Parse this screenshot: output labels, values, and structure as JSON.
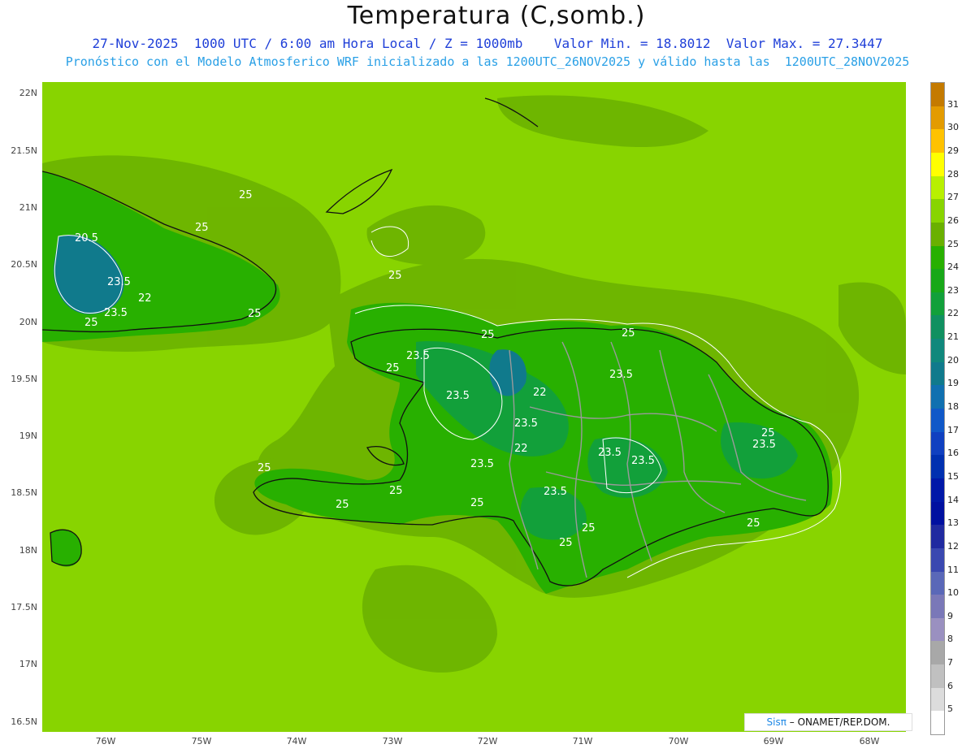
{
  "title": "Temperatura (C,somb.)",
  "subtitle_line1": "27-Nov-2025  1000 UTC / 6:00 am Hora Local / Z = 1000mb    Valor Min. = 18.8012  Valor Max. = 27.3447",
  "subtitle_line2": "Pronóstico con el Modelo Atmosferico WRF inicializado a las 1200UTC_26NOV2025 y válido hasta las  1200UTC_28NOV2025",
  "lat_labels": [
    "22N",
    "21.5N",
    "21N",
    "20.5N",
    "20N",
    "19.5N",
    "19N",
    "18.5N",
    "18N",
    "17.5N",
    "17N",
    "16.5N"
  ],
  "lon_labels": [
    "76W",
    "75W",
    "74W",
    "73W",
    "72W",
    "71W",
    "70W",
    "69W",
    "68W"
  ],
  "contour_labels": [
    "25",
    "25",
    "20.5",
    "23.5",
    "22",
    "23.5",
    "25",
    "25",
    "25",
    "25",
    "23.5",
    "25",
    "22",
    "23.5",
    "23.5",
    "22",
    "23.5",
    "25",
    "23.5",
    "25",
    "23.5",
    "23.5",
    "23.5",
    "25",
    "25",
    "25",
    "25",
    "25",
    "25",
    "23.5",
    "25"
  ],
  "legend": {
    "values": [
      "31",
      "30",
      "29",
      "28",
      "27",
      "26",
      "25",
      "24",
      "23",
      "22",
      "21",
      "20",
      "19",
      "18",
      "17",
      "16",
      "15",
      "14",
      "13",
      "12",
      "11",
      "10",
      "9",
      "8",
      "7",
      "6",
      "5"
    ],
    "colors": [
      "#c47a00",
      "#e39b00",
      "#ffc200",
      "#ffff00",
      "#b8f000",
      "#88d400",
      "#6ab000",
      "#28b000",
      "#18a818",
      "#12a03a",
      "#109060",
      "#10887c",
      "#107a8c",
      "#1070b0",
      "#1058c8",
      "#1040c0",
      "#0030b0",
      "#0018a8",
      "#0010a0",
      "#202aa0",
      "#3a48b0",
      "#5a68b8",
      "#7a78b8",
      "#9a90c0",
      "#a8a8a8",
      "#c0c0c0",
      "#dcdcdc",
      "#ffffff"
    ]
  },
  "credit": {
    "brand": "Sisπ",
    "text": " – ONAMET/REP.DOM."
  }
}
